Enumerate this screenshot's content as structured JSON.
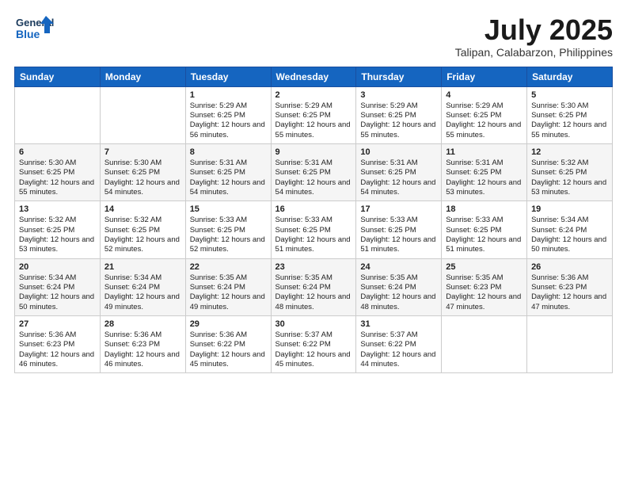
{
  "header": {
    "logo_line1": "General",
    "logo_line2": "Blue",
    "title": "July 2025",
    "subtitle": "Talipan, Calabarzon, Philippines"
  },
  "days_of_week": [
    "Sunday",
    "Monday",
    "Tuesday",
    "Wednesday",
    "Thursday",
    "Friday",
    "Saturday"
  ],
  "weeks": [
    [
      {
        "day": "",
        "sunrise": "",
        "sunset": "",
        "daylight": ""
      },
      {
        "day": "",
        "sunrise": "",
        "sunset": "",
        "daylight": ""
      },
      {
        "day": "1",
        "sunrise": "Sunrise: 5:29 AM",
        "sunset": "Sunset: 6:25 PM",
        "daylight": "Daylight: 12 hours and 56 minutes."
      },
      {
        "day": "2",
        "sunrise": "Sunrise: 5:29 AM",
        "sunset": "Sunset: 6:25 PM",
        "daylight": "Daylight: 12 hours and 55 minutes."
      },
      {
        "day": "3",
        "sunrise": "Sunrise: 5:29 AM",
        "sunset": "Sunset: 6:25 PM",
        "daylight": "Daylight: 12 hours and 55 minutes."
      },
      {
        "day": "4",
        "sunrise": "Sunrise: 5:29 AM",
        "sunset": "Sunset: 6:25 PM",
        "daylight": "Daylight: 12 hours and 55 minutes."
      },
      {
        "day": "5",
        "sunrise": "Sunrise: 5:30 AM",
        "sunset": "Sunset: 6:25 PM",
        "daylight": "Daylight: 12 hours and 55 minutes."
      }
    ],
    [
      {
        "day": "6",
        "sunrise": "Sunrise: 5:30 AM",
        "sunset": "Sunset: 6:25 PM",
        "daylight": "Daylight: 12 hours and 55 minutes."
      },
      {
        "day": "7",
        "sunrise": "Sunrise: 5:30 AM",
        "sunset": "Sunset: 6:25 PM",
        "daylight": "Daylight: 12 hours and 54 minutes."
      },
      {
        "day": "8",
        "sunrise": "Sunrise: 5:31 AM",
        "sunset": "Sunset: 6:25 PM",
        "daylight": "Daylight: 12 hours and 54 minutes."
      },
      {
        "day": "9",
        "sunrise": "Sunrise: 5:31 AM",
        "sunset": "Sunset: 6:25 PM",
        "daylight": "Daylight: 12 hours and 54 minutes."
      },
      {
        "day": "10",
        "sunrise": "Sunrise: 5:31 AM",
        "sunset": "Sunset: 6:25 PM",
        "daylight": "Daylight: 12 hours and 54 minutes."
      },
      {
        "day": "11",
        "sunrise": "Sunrise: 5:31 AM",
        "sunset": "Sunset: 6:25 PM",
        "daylight": "Daylight: 12 hours and 53 minutes."
      },
      {
        "day": "12",
        "sunrise": "Sunrise: 5:32 AM",
        "sunset": "Sunset: 6:25 PM",
        "daylight": "Daylight: 12 hours and 53 minutes."
      }
    ],
    [
      {
        "day": "13",
        "sunrise": "Sunrise: 5:32 AM",
        "sunset": "Sunset: 6:25 PM",
        "daylight": "Daylight: 12 hours and 53 minutes."
      },
      {
        "day": "14",
        "sunrise": "Sunrise: 5:32 AM",
        "sunset": "Sunset: 6:25 PM",
        "daylight": "Daylight: 12 hours and 52 minutes."
      },
      {
        "day": "15",
        "sunrise": "Sunrise: 5:33 AM",
        "sunset": "Sunset: 6:25 PM",
        "daylight": "Daylight: 12 hours and 52 minutes."
      },
      {
        "day": "16",
        "sunrise": "Sunrise: 5:33 AM",
        "sunset": "Sunset: 6:25 PM",
        "daylight": "Daylight: 12 hours and 51 minutes."
      },
      {
        "day": "17",
        "sunrise": "Sunrise: 5:33 AM",
        "sunset": "Sunset: 6:25 PM",
        "daylight": "Daylight: 12 hours and 51 minutes."
      },
      {
        "day": "18",
        "sunrise": "Sunrise: 5:33 AM",
        "sunset": "Sunset: 6:25 PM",
        "daylight": "Daylight: 12 hours and 51 minutes."
      },
      {
        "day": "19",
        "sunrise": "Sunrise: 5:34 AM",
        "sunset": "Sunset: 6:24 PM",
        "daylight": "Daylight: 12 hours and 50 minutes."
      }
    ],
    [
      {
        "day": "20",
        "sunrise": "Sunrise: 5:34 AM",
        "sunset": "Sunset: 6:24 PM",
        "daylight": "Daylight: 12 hours and 50 minutes."
      },
      {
        "day": "21",
        "sunrise": "Sunrise: 5:34 AM",
        "sunset": "Sunset: 6:24 PM",
        "daylight": "Daylight: 12 hours and 49 minutes."
      },
      {
        "day": "22",
        "sunrise": "Sunrise: 5:35 AM",
        "sunset": "Sunset: 6:24 PM",
        "daylight": "Daylight: 12 hours and 49 minutes."
      },
      {
        "day": "23",
        "sunrise": "Sunrise: 5:35 AM",
        "sunset": "Sunset: 6:24 PM",
        "daylight": "Daylight: 12 hours and 48 minutes."
      },
      {
        "day": "24",
        "sunrise": "Sunrise: 5:35 AM",
        "sunset": "Sunset: 6:24 PM",
        "daylight": "Daylight: 12 hours and 48 minutes."
      },
      {
        "day": "25",
        "sunrise": "Sunrise: 5:35 AM",
        "sunset": "Sunset: 6:23 PM",
        "daylight": "Daylight: 12 hours and 47 minutes."
      },
      {
        "day": "26",
        "sunrise": "Sunrise: 5:36 AM",
        "sunset": "Sunset: 6:23 PM",
        "daylight": "Daylight: 12 hours and 47 minutes."
      }
    ],
    [
      {
        "day": "27",
        "sunrise": "Sunrise: 5:36 AM",
        "sunset": "Sunset: 6:23 PM",
        "daylight": "Daylight: 12 hours and 46 minutes."
      },
      {
        "day": "28",
        "sunrise": "Sunrise: 5:36 AM",
        "sunset": "Sunset: 6:23 PM",
        "daylight": "Daylight: 12 hours and 46 minutes."
      },
      {
        "day": "29",
        "sunrise": "Sunrise: 5:36 AM",
        "sunset": "Sunset: 6:22 PM",
        "daylight": "Daylight: 12 hours and 45 minutes."
      },
      {
        "day": "30",
        "sunrise": "Sunrise: 5:37 AM",
        "sunset": "Sunset: 6:22 PM",
        "daylight": "Daylight: 12 hours and 45 minutes."
      },
      {
        "day": "31",
        "sunrise": "Sunrise: 5:37 AM",
        "sunset": "Sunset: 6:22 PM",
        "daylight": "Daylight: 12 hours and 44 minutes."
      },
      {
        "day": "",
        "sunrise": "",
        "sunset": "",
        "daylight": ""
      },
      {
        "day": "",
        "sunrise": "",
        "sunset": "",
        "daylight": ""
      }
    ]
  ]
}
